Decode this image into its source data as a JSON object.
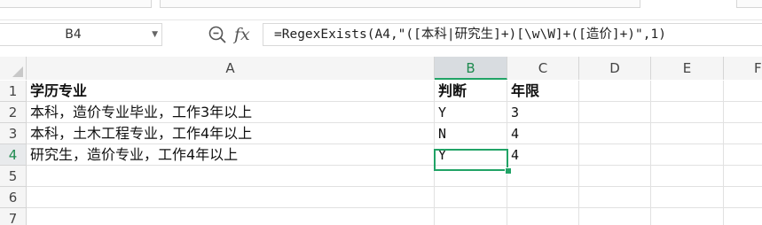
{
  "name_box": {
    "value": "B4"
  },
  "formula_bar": {
    "function_icon": "fx-icon",
    "zoom_icon": "zoom-icon",
    "formula": "=RegexExists(A4,\"([本科|研究生]+)[\\w\\W]+([造价]+)\",1)"
  },
  "columns": [
    "A",
    "B",
    "C",
    "D",
    "E",
    "F"
  ],
  "rows": [
    "1",
    "2",
    "3",
    "4",
    "5",
    "6",
    "7"
  ],
  "active_cell": {
    "column": "B",
    "row": "4"
  },
  "cells": {
    "A1": "学历专业",
    "B1": "判断",
    "C1": "年限",
    "A2": "本科，造价专业毕业，工作3年以上",
    "B2": "Y",
    "C2": "3",
    "A3": "本科，土木工程专业，工作4年以上",
    "B3": "N",
    "C3": "4",
    "A4": "研究生，造价专业，工作4年以上",
    "B4": "Y",
    "C4": "4"
  },
  "colors": {
    "accent": "#21a366",
    "active_header_text": "#1e8a4f",
    "gridline": "#e1e1e1"
  }
}
